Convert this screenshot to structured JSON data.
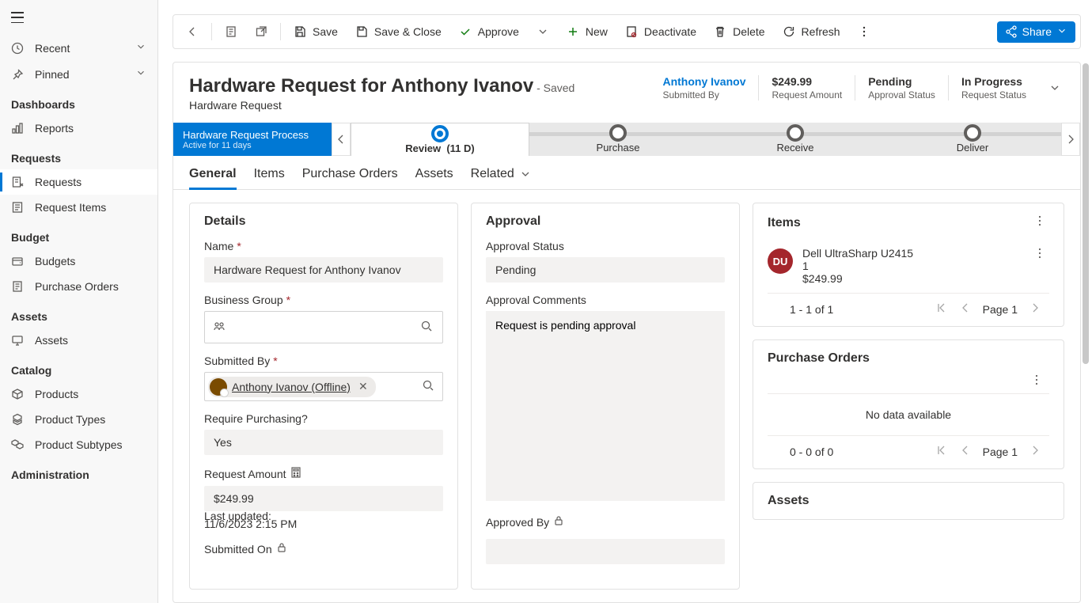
{
  "sidebar": {
    "recent": "Recent",
    "pinned": "Pinned",
    "sections": {
      "dashboards": "Dashboards",
      "requests": "Requests",
      "budget": "Budget",
      "assets": "Assets",
      "catalog": "Catalog",
      "administration": "Administration"
    },
    "items": {
      "reports": "Reports",
      "requests": "Requests",
      "requestItems": "Request Items",
      "budgets": "Budgets",
      "purchaseOrders": "Purchase Orders",
      "assets": "Assets",
      "products": "Products",
      "productTypes": "Product Types",
      "productSubtypes": "Product Subtypes"
    }
  },
  "commands": {
    "save": "Save",
    "saveClose": "Save & Close",
    "approve": "Approve",
    "new": "New",
    "deactivate": "Deactivate",
    "delete": "Delete",
    "refresh": "Refresh",
    "share": "Share"
  },
  "record": {
    "title": "Hardware Request for Anthony Ivanov",
    "savedSuffix": "- Saved",
    "subtitle": "Hardware Request",
    "kpis": {
      "submittedBy": {
        "value": "Anthony Ivanov",
        "label": "Submitted By"
      },
      "amount": {
        "value": "$249.99",
        "label": "Request Amount"
      },
      "approval": {
        "value": "Pending",
        "label": "Approval Status"
      },
      "status": {
        "value": "In Progress",
        "label": "Request Status"
      }
    }
  },
  "bpf": {
    "name": "Hardware Request Process",
    "duration": "Active for 11 days",
    "stages": {
      "review": "Review",
      "reviewDur": "(11 D)",
      "purchase": "Purchase",
      "receive": "Receive",
      "deliver": "Deliver"
    }
  },
  "tabs": {
    "general": "General",
    "items": "Items",
    "po": "Purchase Orders",
    "assets": "Assets",
    "related": "Related"
  },
  "details": {
    "title": "Details",
    "nameLabel": "Name",
    "nameValue": "Hardware Request for Anthony Ivanov",
    "bgLabel": "Business Group",
    "submittedByLabel": "Submitted By",
    "submittedByValue": "Anthony Ivanov (Offline)",
    "requirePurchasingLabel": "Require Purchasing?",
    "requirePurchasingValue": "Yes",
    "amountLabel": "Request Amount",
    "amountValue": "$249.99",
    "lastUpdatedLabel": "Last updated:",
    "lastUpdatedValue": "11/6/2023 2:15 PM",
    "submittedOnLabel": "Submitted On"
  },
  "approval": {
    "title": "Approval",
    "statusLabel": "Approval Status",
    "statusValue": "Pending",
    "commentsLabel": "Approval Comments",
    "commentsValue": "Request is pending approval",
    "approvedByLabel": "Approved By"
  },
  "sideCards": {
    "items": {
      "title": "Items",
      "item1": {
        "name": "Dell UltraSharp U2415",
        "qty": "1",
        "price": "$249.99",
        "initials": "DU"
      },
      "pageInfo": "1 - 1 of 1",
      "pageLabel": "Page 1"
    },
    "po": {
      "title": "Purchase Orders",
      "noData": "No data available",
      "pageInfo": "0 - 0 of 0",
      "pageLabel": "Page 1"
    },
    "assets": {
      "title": "Assets"
    }
  }
}
